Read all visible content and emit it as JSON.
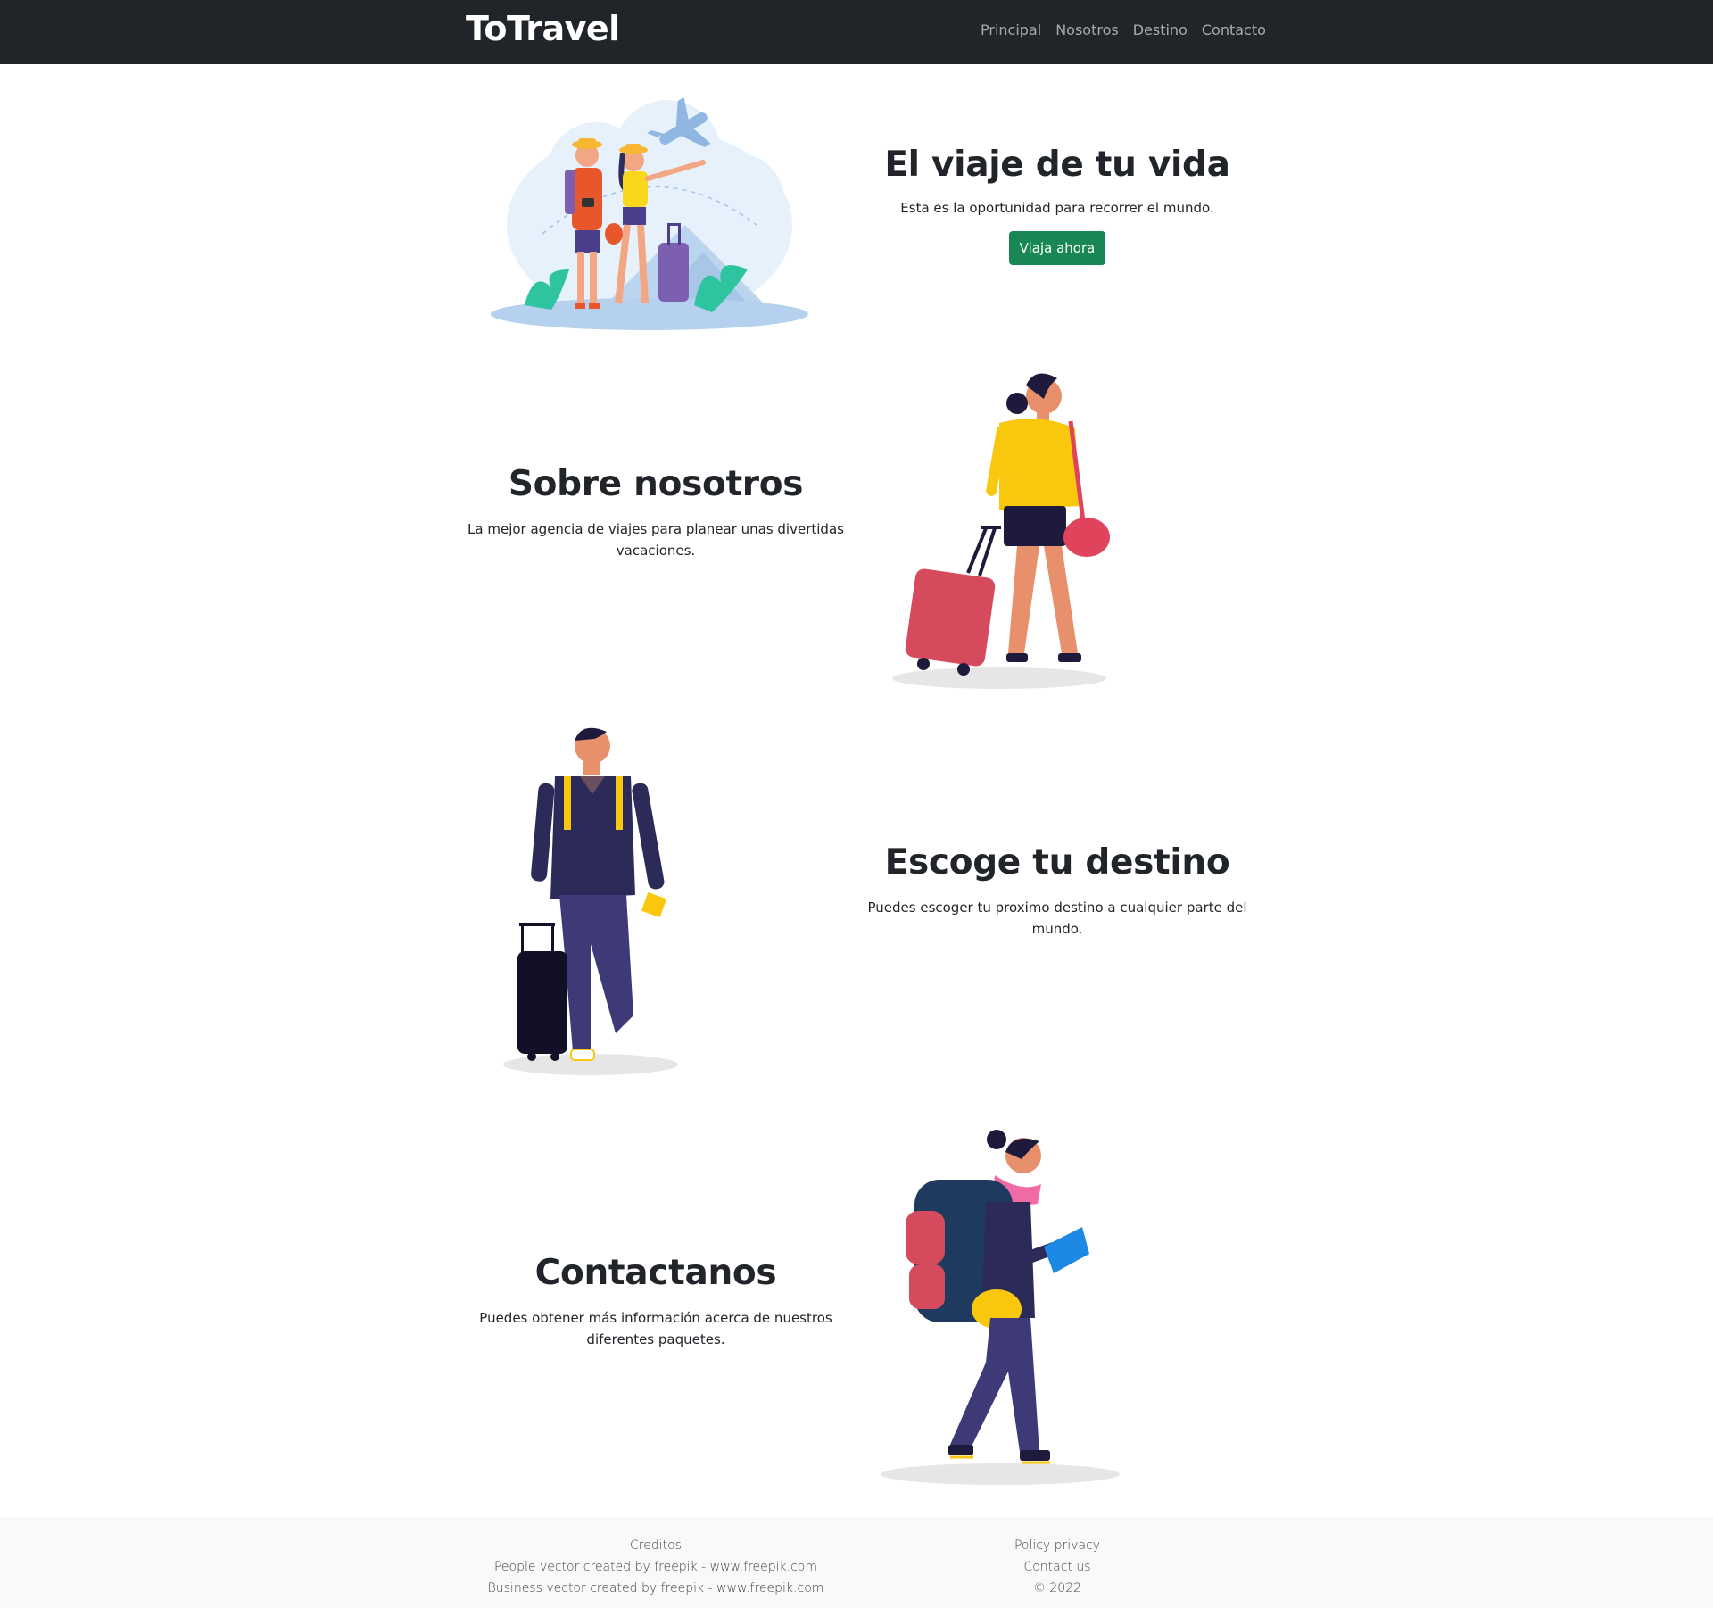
{
  "navbar": {
    "brand": "ToTravel",
    "links": [
      "Principal",
      "Nosotros",
      "Destino",
      "Contacto"
    ]
  },
  "hero": {
    "title": "El viaje de tu vida",
    "text": "Esta es la oportunidad para recorrer el mundo.",
    "button": "Viaja ahora"
  },
  "about": {
    "title": "Sobre nosotros",
    "text": "La mejor agencia de viajes para planear unas divertidas vacaciones."
  },
  "destination": {
    "title": "Escoge tu destino",
    "text": "Puedes escoger tu proximo destino a cualquier parte del mundo."
  },
  "contact": {
    "title": "Contactanos",
    "text": "Puedes obtener más información acerca de nuestros diferentes paquetes."
  },
  "footer": {
    "credits_title": "Creditos",
    "credit_1": "People vector created by freepik - www.freepik.com",
    "credit_2": "Business vector created by freepik - www.freepik.com",
    "policy": "Policy privacy",
    "contact_us": "Contact us",
    "copyright": "© 2022"
  },
  "colors": {
    "navbar_bg": "#212529",
    "button_green": "#198754",
    "footer_bg": "#f8f9fa"
  }
}
